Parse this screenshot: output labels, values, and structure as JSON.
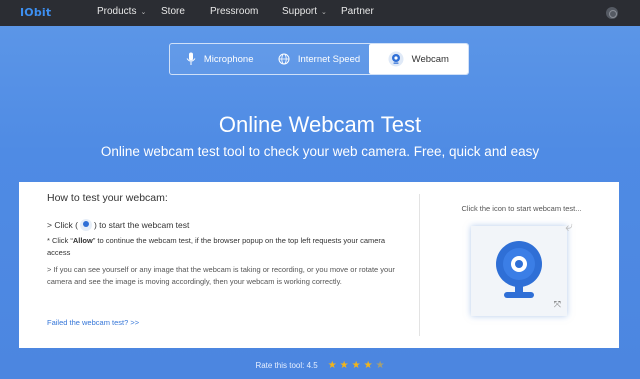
{
  "nav": {
    "logo": "IObit",
    "items": [
      {
        "label": "Products",
        "has_menu": true
      },
      {
        "label": "Store",
        "has_menu": false
      },
      {
        "label": "Pressroom",
        "has_menu": false
      },
      {
        "label": "Support",
        "has_menu": true
      },
      {
        "label": "Partner",
        "has_menu": false
      }
    ],
    "chevron": "⌄"
  },
  "tabs": [
    {
      "label": "Microphone",
      "icon": "microphone-icon",
      "active": false
    },
    {
      "label": "Internet Speed",
      "icon": "globe-icon",
      "active": false
    },
    {
      "label": "Webcam",
      "icon": "webcam-icon",
      "active": true
    }
  ],
  "hero": {
    "title": "Online Webcam Test",
    "subtitle": "Online webcam test tool to check your web camera. Free, quick and easy"
  },
  "howto": {
    "title": "How to test your webcam:",
    "step1_prefix": "> Click (",
    "step1_suffix": ") to start the webcam test",
    "note1_prefix": "* Click “",
    "note1_bold": "Allow",
    "note1_suffix": "” to continue the webcam test, if the browser popup on the top left requests your camera access",
    "note2": "> If you can see yourself or any image that the webcam is taking or recording, or you move or rotate your camera and see the image is moving accordingly, then your webcam is working correctly.",
    "failed_link": "Failed the webcam test? >>"
  },
  "webcam_panel": {
    "hint": "Click the icon to start webcam test..."
  },
  "rating": {
    "label": "Rate this tool: 4.5",
    "value": 4.5,
    "max": 5
  },
  "colors": {
    "accent": "#2f6fd6",
    "star": "#f3b519",
    "nav_bg": "#2b2d33"
  }
}
